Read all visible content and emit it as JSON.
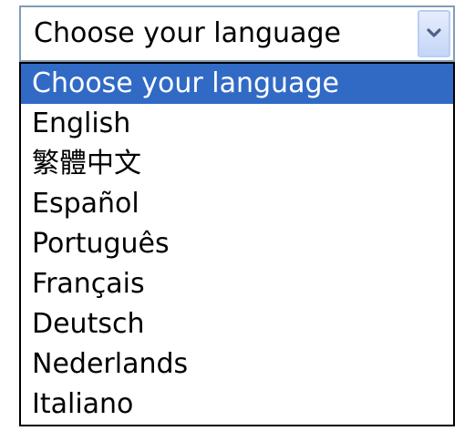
{
  "select": {
    "value": "Choose your language",
    "dropdown_icon": "chevron-down-icon"
  },
  "options": [
    {
      "label": "Choose your language",
      "selected": true
    },
    {
      "label": "English",
      "selected": false
    },
    {
      "label": "繁體中文",
      "selected": false
    },
    {
      "label": "Español",
      "selected": false
    },
    {
      "label": "Português",
      "selected": false
    },
    {
      "label": "Français",
      "selected": false
    },
    {
      "label": "Deutsch",
      "selected": false
    },
    {
      "label": "Nederlands",
      "selected": false
    },
    {
      "label": "Italiano",
      "selected": false
    }
  ],
  "colors": {
    "highlight": "#316ac5",
    "highlight_text": "#ffffff",
    "select_border": "#7f9db9",
    "list_border": "#000000"
  }
}
